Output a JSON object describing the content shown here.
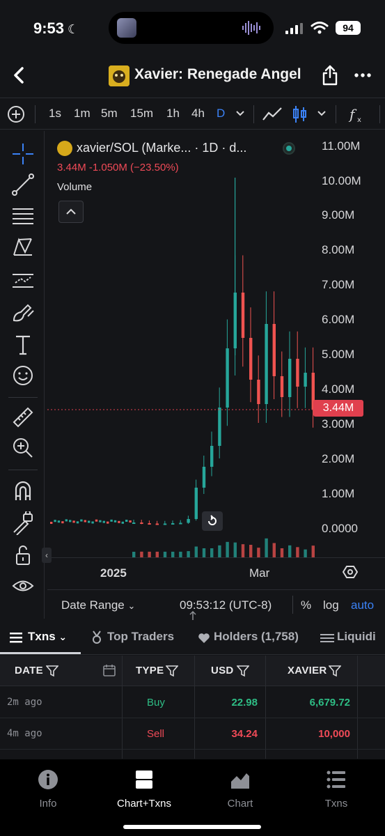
{
  "status": {
    "time": "9:53",
    "battery": "94"
  },
  "header": {
    "title": "Xavier: Renegade Angel"
  },
  "toolbar": {
    "timeframes": [
      "1s",
      "1m",
      "5m",
      "15m",
      "1h",
      "4h",
      "D"
    ],
    "active_timeframe": "D"
  },
  "chart": {
    "legend_pair": "xavier/SOL (Marke... · 1D · d...",
    "legend_change": "3.44M  -1.050M (−23.50%)",
    "volume_label": "Volume",
    "y_ticks": [
      "11.00M",
      "10.00M",
      "9.00M",
      "8.00M",
      "7.00M",
      "6.00M",
      "5.00M",
      "4.00M",
      "3.00M",
      "2.00M",
      "1.00M",
      "0.0000"
    ],
    "current_price": "3.44M",
    "x_ticks": [
      "2025",
      "Mar"
    ],
    "colors": {
      "up": "#26a69a",
      "down": "#ef5350",
      "price_line": "#e0404e"
    }
  },
  "chart_data": {
    "type": "bar",
    "title": "xavier/SOL (Marke... · 1D · d...",
    "xlabel": "",
    "ylabel": "",
    "ylim": [
      0,
      11000000
    ],
    "x_ticks": [
      "2025",
      "Mar"
    ],
    "current": 3440000,
    "change": -1050000,
    "change_pct": -23.5,
    "candles_close_approx": [
      200000,
      180000,
      170000,
      160000,
      170000,
      180000,
      190000,
      300000,
      1200000,
      1800000,
      2400000,
      3500000,
      5200000,
      6800000,
      5500000,
      4300000,
      3600000,
      5900000,
      4400000,
      3800000,
      4900000,
      4100000,
      4500000,
      3440000
    ]
  },
  "date_bar": {
    "range_label": "Date Range",
    "clock": "09:53:12 (UTC-8)",
    "pct": "%",
    "log": "log",
    "auto": "auto"
  },
  "tabs": [
    "Txns",
    "Top Traders",
    "Holders (1,758)",
    "Liquidi"
  ],
  "table": {
    "headers": [
      "DATE",
      "TYPE",
      "USD",
      "XAVIER"
    ],
    "rows": [
      {
        "date": "2m ago",
        "type": "Buy",
        "usd": "22.98",
        "amount": "6,679.72"
      },
      {
        "date": "4m ago",
        "type": "Sell",
        "usd": "34.24",
        "amount": "10,000"
      }
    ]
  },
  "nav": [
    "Info",
    "Chart+Txns",
    "Chart",
    "Txns"
  ]
}
